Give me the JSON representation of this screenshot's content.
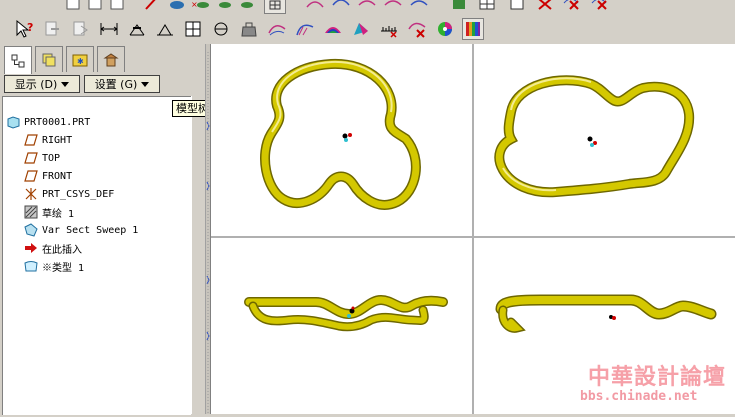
{
  "toolbar": {
    "top_icons": [
      "sketch-view-icon",
      "eye-icon",
      "hide-icon",
      "show-icon",
      "shade-icon",
      "pattern-icon",
      "curve-icon",
      "curve2-icon",
      "table-icon",
      "graph-icon",
      "color-icon",
      "delete-icon",
      "delete2-icon",
      "delete3-icon"
    ],
    "icons": [
      "help-icon",
      "copy-icon",
      "paste-icon",
      "dimension-icon",
      "datum-icon",
      "measure-icon",
      "section-icon",
      "angle-icon",
      "radius-icon",
      "weight-icon",
      "curve-analysis-icon",
      "curvature-icon",
      "surface-analysis-icon",
      "shade-analysis-icon",
      "ruler-icon",
      "delete-analysis-icon",
      "remove-analysis-icon",
      "color-wheel-icon",
      "color-bars-icon"
    ]
  },
  "nav_tabs": [
    "model-tree-tab",
    "layers-tab",
    "favorites-tab",
    "connections-tab"
  ],
  "show_menu": {
    "label": "显示 (D)"
  },
  "settings_menu": {
    "label": "设置 (G)"
  },
  "tooltip": "模型树",
  "tree": {
    "root": "PRT0001.PRT",
    "items": [
      {
        "label": "RIGHT",
        "icon": "datum-plane-icon"
      },
      {
        "label": "TOP",
        "icon": "datum-plane-icon"
      },
      {
        "label": "FRONT",
        "icon": "datum-plane-icon"
      },
      {
        "label": "PRT_CSYS_DEF",
        "icon": "csys-icon"
      },
      {
        "label": "草绘 1",
        "icon": "sketch-icon"
      },
      {
        "label": "Var Sect Sweep 1",
        "icon": "sweep-icon"
      },
      {
        "label": "在此插入",
        "icon": "insert-arrow-icon"
      },
      {
        "label": "※类型 1",
        "icon": "type-icon"
      }
    ]
  },
  "watermark": {
    "title": "中華設計論壇",
    "url": "bbs.chinade.net"
  },
  "colors": {
    "model": "#d4c800",
    "model_dark": "#8a8200",
    "tooltip_bg": "#ffffe1",
    "watermark": "#f6a0a8"
  }
}
